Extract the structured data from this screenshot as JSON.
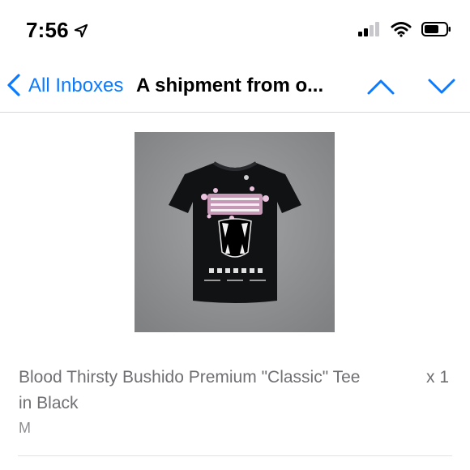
{
  "status_bar": {
    "time": "7:56",
    "icons": [
      "location-arrow-icon",
      "cellular-signal-icon",
      "wifi-icon",
      "battery-icon"
    ]
  },
  "nav": {
    "back_label": "All Inboxes",
    "title": "A shipment from o...",
    "icons": [
      "chevron-left-icon",
      "chevron-up-icon",
      "chevron-down-icon"
    ],
    "accent_color": "#0a7aff"
  },
  "product": {
    "image_icon": "black-tshirt-image",
    "name": "Blood Thirsty Bushido Premium \"Classic\" Tee in Black",
    "quantity": "x 1",
    "size": "M"
  }
}
